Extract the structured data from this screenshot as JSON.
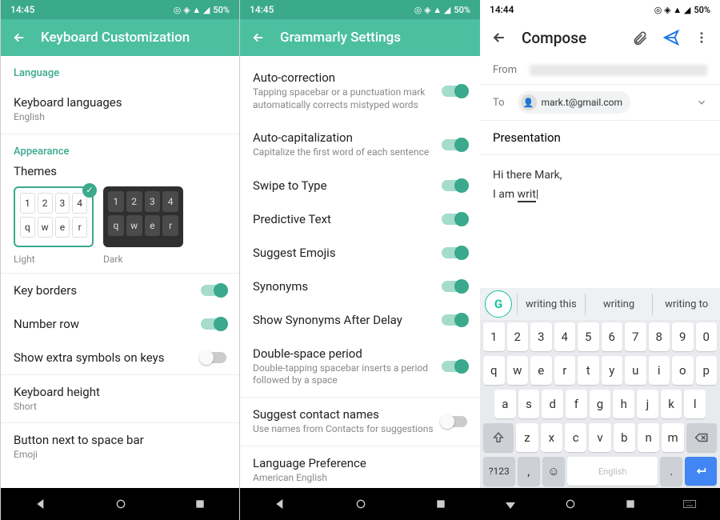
{
  "status": {
    "time1": "14:45",
    "time2": "14:45",
    "time3": "14:44",
    "battery": "50%"
  },
  "screen1": {
    "title": "Keyboard Customization",
    "sections": {
      "language": "Language",
      "appearance": "Appearance"
    },
    "rows": {
      "kb_lang": {
        "title": "Keyboard languages",
        "sub": "English"
      },
      "themes": "Themes",
      "light": "Light",
      "dark": "Dark",
      "key_borders": "Key borders",
      "number_row": "Number row",
      "extra_symbols": "Show extra symbols on keys",
      "kb_height": {
        "title": "Keyboard height",
        "sub": "Short"
      },
      "btn_space": {
        "title": "Button next to space bar",
        "sub": "Emoji"
      }
    },
    "theme_keys_num": [
      "1",
      "2",
      "3",
      "4"
    ],
    "theme_keys_alpha": [
      "q",
      "w",
      "e",
      "r"
    ]
  },
  "screen2": {
    "title": "Grammarly Settings",
    "rows": {
      "autocorrect": {
        "title": "Auto-correction",
        "sub": "Tapping spacebar or a punctuation mark automatically corrects mistyped words"
      },
      "autocap": {
        "title": "Auto-capitalization",
        "sub": "Capitalize the first word of each sentence"
      },
      "swipe": "Swipe to Type",
      "predictive": "Predictive Text",
      "emojis": "Suggest Emojis",
      "synonyms": "Synonyms",
      "syn_delay": "Show Synonyms After Delay",
      "dbl_space": {
        "title": "Double-space period",
        "sub": "Double-tapping spacebar inserts a period followed by a space"
      },
      "contacts": {
        "title": "Suggest contact names",
        "sub": "Use names from Contacts for suggestions"
      },
      "lang_pref": {
        "title": "Language Preference",
        "sub": "American English"
      }
    }
  },
  "screen3": {
    "title": "Compose",
    "from_label": "From",
    "to_label": "To",
    "to_value": "mark.t@gmail.com",
    "subject": "Presentation",
    "body_line1": "Hi there Mark,",
    "body_line2a": "I am ",
    "body_line2b": "writ",
    "suggestions": [
      "writing this",
      "writing",
      "writing to"
    ],
    "keys_num": [
      "1",
      "2",
      "3",
      "4",
      "5",
      "6",
      "7",
      "8",
      "9",
      "0"
    ],
    "keys_r1": [
      "q",
      "w",
      "e",
      "r",
      "t",
      "y",
      "u",
      "i",
      "o",
      "p"
    ],
    "keys_r2": [
      "a",
      "s",
      "d",
      "f",
      "g",
      "h",
      "j",
      "k",
      "l"
    ],
    "keys_r3": [
      "z",
      "x",
      "c",
      "v",
      "b",
      "n",
      "m"
    ],
    "key_numtoggle": "?123",
    "key_comma": ",",
    "key_period": ".",
    "key_space": "English"
  }
}
